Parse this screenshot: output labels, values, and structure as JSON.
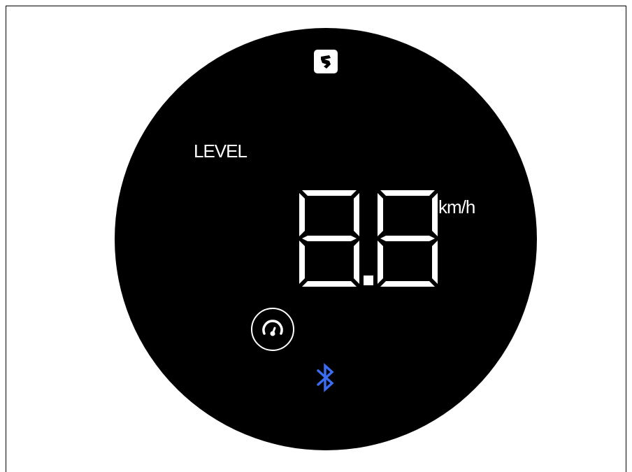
{
  "display": {
    "level_label": "LEVEL",
    "speed_digits": [
      "8",
      "8"
    ],
    "speed_value": "8.8",
    "speed_unit": "km/h"
  },
  "icons": {
    "brand": "brand-logo-icon",
    "speed_mode": "speedometer-icon",
    "connectivity": "bluetooth-icon"
  },
  "colors": {
    "background": "#000000",
    "segment": "#ffffff",
    "bluetooth": "#3a6cf0"
  }
}
